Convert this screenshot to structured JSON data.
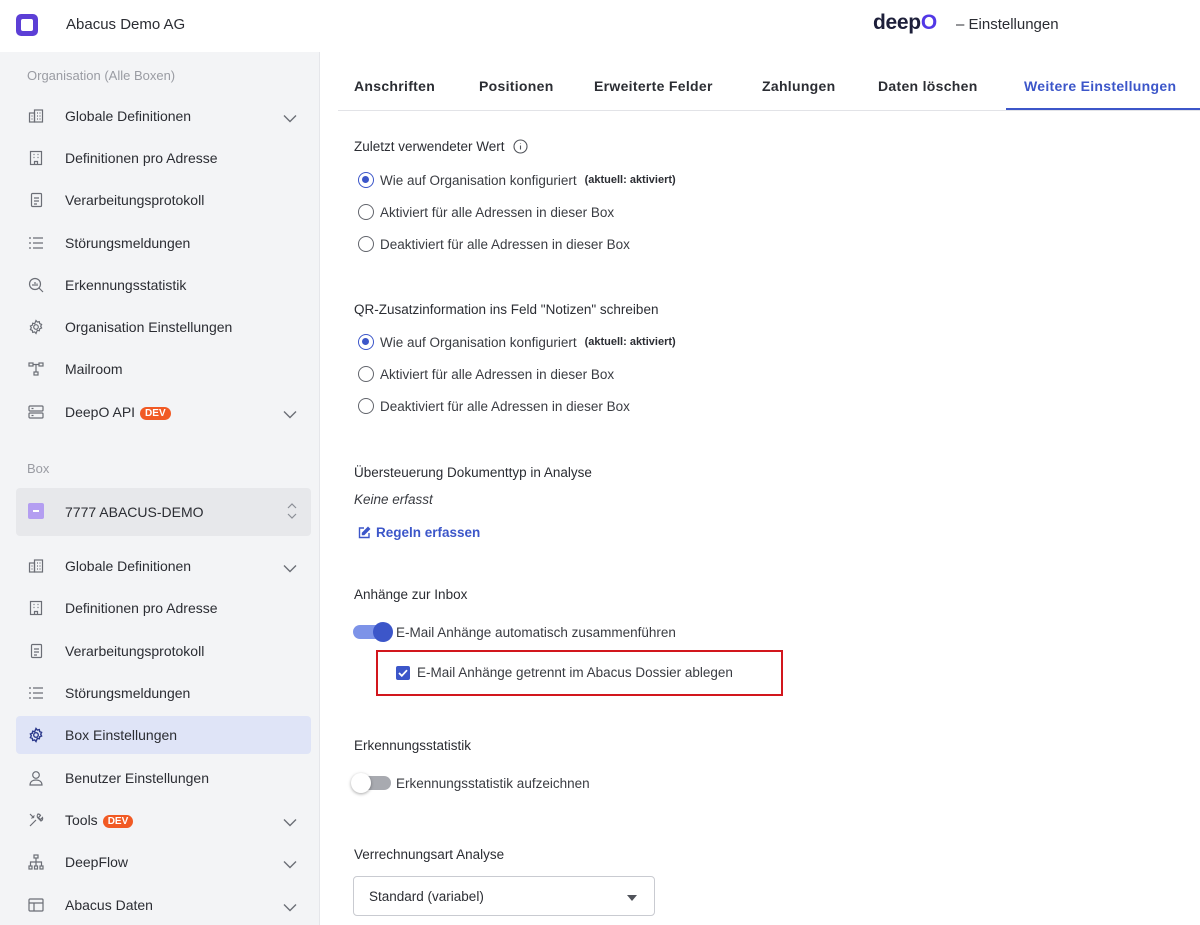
{
  "header": {
    "org_name": "Abacus Demo AG",
    "brand_text": "deep",
    "brand_o": "O",
    "page_title": "– Einstellungen"
  },
  "sidebar": {
    "org_section_label": "Organisation (Alle Boxen)",
    "org_items": [
      {
        "label": "Globale Definitionen",
        "icon": "building-grid-icon",
        "expandable": true
      },
      {
        "label": "Definitionen pro Adresse",
        "icon": "building-icon",
        "expandable": false
      },
      {
        "label": "Verarbeitungsprotokoll",
        "icon": "document-icon",
        "expandable": false
      },
      {
        "label": "Störungsmeldungen",
        "icon": "list-icon",
        "expandable": false
      },
      {
        "label": "Erkennungsstatistik",
        "icon": "magnifier-chart-icon",
        "expandable": false
      },
      {
        "label": "Organisation Einstellungen",
        "icon": "gear-icon",
        "expandable": false
      },
      {
        "label": "Mailroom",
        "icon": "flow-icon",
        "expandable": false
      },
      {
        "label": "DeepO API",
        "icon": "server-icon",
        "badge": "DEV",
        "expandable": true
      }
    ],
    "box_section_label": "Box",
    "box_selector": "7777 ABACUS-DEMO",
    "box_items": [
      {
        "label": "Globale Definitionen",
        "icon": "building-grid-icon",
        "expandable": true
      },
      {
        "label": "Definitionen pro Adresse",
        "icon": "building-icon",
        "expandable": false
      },
      {
        "label": "Verarbeitungsprotokoll",
        "icon": "document-icon",
        "expandable": false
      },
      {
        "label": "Störungsmeldungen",
        "icon": "list-icon",
        "expandable": false
      },
      {
        "label": "Box Einstellungen",
        "icon": "gear-icon",
        "expandable": false,
        "active": true
      },
      {
        "label": "Benutzer Einstellungen",
        "icon": "user-icon",
        "expandable": false
      },
      {
        "label": "Tools",
        "icon": "tools-icon",
        "badge": "DEV",
        "expandable": true
      },
      {
        "label": "DeepFlow",
        "icon": "hierarchy-icon",
        "expandable": true
      },
      {
        "label": "Abacus Daten",
        "icon": "table-icon",
        "expandable": true
      }
    ]
  },
  "tabs": [
    {
      "label": "Anschriften",
      "active": false
    },
    {
      "label": "Positionen",
      "active": false
    },
    {
      "label": "Erweiterte Felder",
      "active": false
    },
    {
      "label": "Zahlungen",
      "active": false
    },
    {
      "label": "Daten löschen",
      "active": false
    },
    {
      "label": "Weitere Einstellungen",
      "active": true
    }
  ],
  "settings": {
    "last_value": {
      "title": "Zuletzt verwendeter Wert",
      "options": [
        {
          "label": "Wie auf Organisation konfiguriert",
          "note": "(aktuell: aktiviert)",
          "selected": true
        },
        {
          "label": "Aktiviert für alle Adressen in dieser Box",
          "note": "",
          "selected": false
        },
        {
          "label": "Deaktiviert für alle Adressen in dieser Box",
          "note": "",
          "selected": false
        }
      ]
    },
    "qr_info": {
      "title": "QR-Zusatzinformation ins Feld \"Notizen\" schreiben",
      "options": [
        {
          "label": "Wie auf Organisation konfiguriert",
          "note": "(aktuell: aktiviert)",
          "selected": true
        },
        {
          "label": "Aktiviert für alle Adressen in dieser Box",
          "note": "",
          "selected": false
        },
        {
          "label": "Deaktiviert für alle Adressen in dieser Box",
          "note": "",
          "selected": false
        }
      ]
    },
    "doc_type_override": {
      "title": "Übersteuerung Dokumenttyp in Analyse",
      "empty_text": "Keine erfasst",
      "link_label": "Regeln erfassen"
    },
    "attachments": {
      "title": "Anhänge zur Inbox",
      "toggle_label": "E-Mail Anhänge automatisch zusammenführen",
      "toggle_on": true,
      "checkbox_label": "E-Mail Anhänge getrennt im Abacus Dossier ablegen",
      "checkbox_checked": true
    },
    "recognition": {
      "title": "Erkennungsstatistik",
      "toggle_label": "Erkennungsstatistik aufzeichnen",
      "toggle_on": false
    },
    "billing": {
      "title": "Verrechnungsart Analyse",
      "selected": "Standard (variabel)"
    }
  },
  "colors": {
    "accent": "#3c56c9",
    "brand": "#5c3fd6",
    "dev_badge": "#f15a24",
    "highlight_border": "#d2161d",
    "sidebar_bg": "#f3f4f6",
    "sidebar_active": "#dfe4f7"
  }
}
